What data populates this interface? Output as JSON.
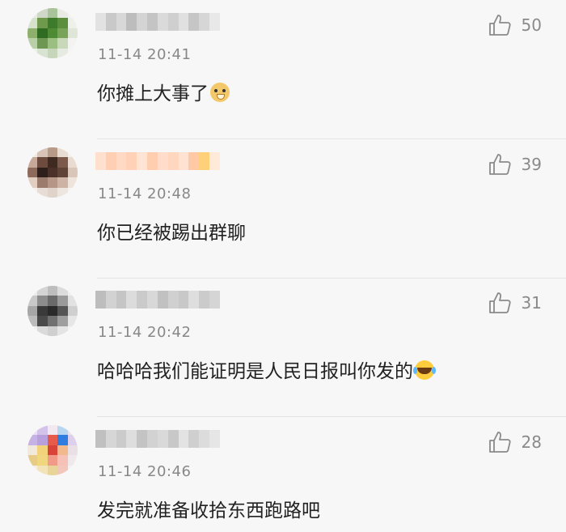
{
  "comments": [
    {
      "time": "11-14 20:41",
      "text": "你摊上大事了",
      "emoji": "doge-emoji",
      "likes": "50",
      "avatar_colors": [
        "#e9ece5",
        "#cfd8c6",
        "#a9c39a",
        "#e8ece4",
        "#f2f2f0",
        "#d6e2cc",
        "#6f9a4d",
        "#3e7a2b",
        "#5c8f3d",
        "#eef0ea",
        "#8fb06d",
        "#2f6b21",
        "#4f8a35",
        "#7aa35a",
        "#dfe6d8",
        "#b9cfa8",
        "#6d9752",
        "#9bbf80",
        "#c8d9ba",
        "#f3f3f1",
        "#eef0ec",
        "#d9e3d1",
        "#c7d6ba",
        "#e5ebe0",
        "#f4f4f2"
      ],
      "name_colors": [
        "#e2e2e2",
        "#c9c9c9",
        "#d8d8d8",
        "#bdbdbd",
        "#d4d4d4",
        "#c4c4c4",
        "#dadada",
        "#cfcfcf",
        "#e0e0e0",
        "#c6c6c6",
        "#d6d6d6",
        "#e8e8e8"
      ]
    },
    {
      "time": "11-14 20:48",
      "text": "你已经被踢出群聊",
      "emoji": "",
      "likes": "39",
      "avatar_colors": [
        "#f1ebe6",
        "#d8c5b8",
        "#b89a88",
        "#e9ddd3",
        "#f4f0ec",
        "#c7a999",
        "#6d4c3f",
        "#3f2a22",
        "#7c5a4b",
        "#eadbd0",
        "#8d6a5a",
        "#2e1f1a",
        "#4a3028",
        "#5f4336",
        "#d9c6b9",
        "#e2cfc2",
        "#9c7c6c",
        "#b69686",
        "#cdb3a4",
        "#efe4dc",
        "#f4f0ed",
        "#e7ddd6",
        "#e0d3ca",
        "#ede5df",
        "#f6f3f1"
      ],
      "name_colors": [
        "#ffe0cf",
        "#ffcfb4",
        "#ffd9c4",
        "#ffd2b8",
        "#ffe4d4",
        "#ffcdb0",
        "#ffddca",
        "#ffd6be",
        "#ffe2d1",
        "#ffc9a6",
        "#ffd07a",
        "#ffe9d9"
      ]
    },
    {
      "time": "11-14 20:42",
      "text": "哈哈哈我们能证明是人民日报叫你发的",
      "emoji": "laugh-cry-emoji",
      "likes": "31",
      "avatar_colors": [
        "#ececec",
        "#d4d4d4",
        "#bdbdbd",
        "#dcdcdc",
        "#efefef",
        "#c8c8c8",
        "#8c8c8c",
        "#6a6a6a",
        "#9a9a9a",
        "#e2e2e2",
        "#a6a6a6",
        "#3a3a3a",
        "#2a2a2a",
        "#555555",
        "#cfcfcf",
        "#bcbcbc",
        "#4a4a4a",
        "#707070",
        "#9e9e9e",
        "#e6e6e6",
        "#f0f0f0",
        "#dadada",
        "#cfcfcf",
        "#e4e4e4",
        "#f3f3f3"
      ],
      "name_colors": [
        "#bdbdbd",
        "#d2d2d2",
        "#c5c5c5",
        "#dcdcdc",
        "#cacaca",
        "#d8d8d8",
        "#c1c1c1",
        "#d0d0d0",
        "#c8c8c8",
        "#dedede",
        "#cbcbcb",
        "#d5d5d5"
      ]
    },
    {
      "time": "11-14 20:46",
      "text": "发完就准备收拾东西跑路吧",
      "emoji": "",
      "likes": "28",
      "avatar_colors": [
        "#e9e1f3",
        "#d3c3ea",
        "#f3e8f0",
        "#b9d6f0",
        "#ebe4ef",
        "#c6b3e3",
        "#b7a0dc",
        "#e85a4a",
        "#2f7de0",
        "#dcd0ec",
        "#f1eadc",
        "#f2d27a",
        "#d8443a",
        "#f1b98c",
        "#e9e0e6",
        "#e6cc86",
        "#f0d77f",
        "#f29a8a",
        "#f6c2b8",
        "#efe9ec",
        "#f3eee8",
        "#f2e3b8",
        "#e9d49a",
        "#f3c6bc",
        "#f5f1ee"
      ],
      "name_colors": [
        "#c0c0c0",
        "#d6d6d6",
        "#cbcbcb",
        "#dedede",
        "#c4c4c4",
        "#d2d2d2",
        "#d9d9d9",
        "#c8c8c8",
        "#e3e3e3",
        "#cfcfcf",
        "#dcdcdc",
        "#e6e6e6"
      ]
    }
  ]
}
